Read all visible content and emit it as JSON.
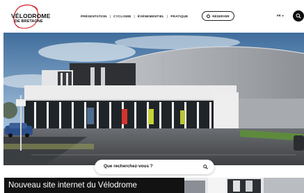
{
  "header": {
    "logo": {
      "line1": "VÉLODROME",
      "line2": "DE BRETAGNE"
    },
    "nav": [
      {
        "label": "PRÉSENTATION"
      },
      {
        "label": "CYCLISME"
      },
      {
        "label": "ÉVÉNEMENTIEL"
      },
      {
        "label": "PRATIQUE"
      }
    ],
    "nav_separator": "|",
    "reserve_label": "RÉSERVER",
    "language": "FR",
    "language_chevron": "▾"
  },
  "search": {
    "placeholder": "Que recherchez-vous ?"
  },
  "news": {
    "title": "Nouveau site internet du Vélodrome"
  },
  "colors": {
    "accent": "#d4282e",
    "dark": "#0e0e0e",
    "sky": "#5b86b4",
    "cladding": "#a9adb2"
  },
  "icons": [
    "logo-swoosh-icon",
    "calendar-icon",
    "chevron-down-icon",
    "search-icon"
  ]
}
